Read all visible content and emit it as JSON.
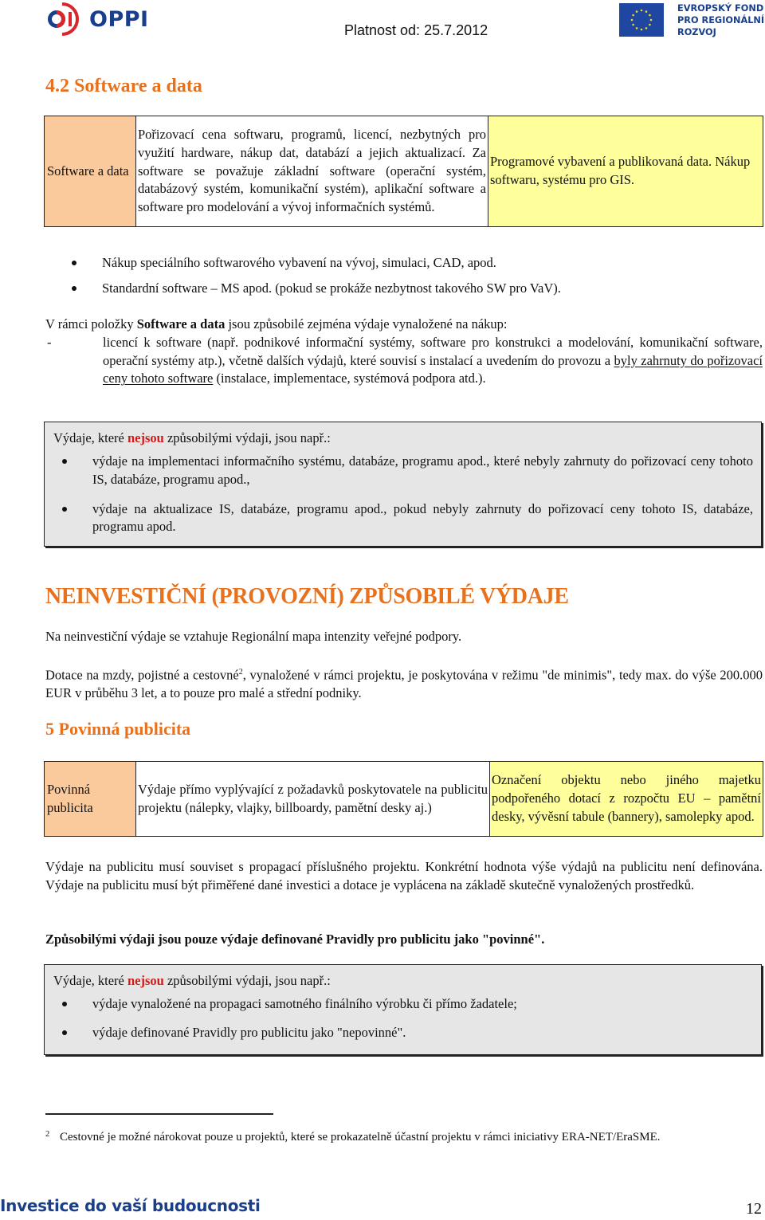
{
  "header": {
    "logo_text": "OPPI",
    "validity": "Platnost od: 25.7.2012",
    "eu_lines": [
      "EVROPSKÝ FOND",
      "PRO REGIONÁLNÍ",
      "ROZVOJ"
    ]
  },
  "colors": {
    "heading_orange": "#e8711e",
    "label_cell": "#fbca9c",
    "example_cell": "#fefe9a",
    "gray_box": "#e6e6e6",
    "emphasis_red": "#d11a1a",
    "brand_blue": "#1a3f8a"
  },
  "section_software": {
    "heading": "4.2 Software a data",
    "table": {
      "label": "Software a data",
      "description": "Pořizovací cena softwaru, programů, licencí, nezbytných pro využití hardware, nákup dat, databází a jejich aktualizací. Za software se považuje základní software (operační systém, databázový systém, komunikační systém), aplikační software a software pro modelování a vývoj informačních systémů.",
      "examples": "Programové vybavení a publikovaná data. Nákup softwaru, systému pro GIS."
    },
    "bullets": [
      "Nákup speciálního softwarového vybavení na vývoj, simulaci, CAD, apod.",
      "Standardní software – MS apod. (pokud se prokáže nezbytnost takového SW pro VaV)."
    ],
    "eligible_intro_pre": "V rámci položky ",
    "eligible_intro_bold": "Software a data",
    "eligible_intro_post": " jsou způsobilé zejména výdaje vynaložené na nákup:",
    "dash_item": {
      "dash": "-",
      "text_pre": "licencí k software (např. podnikové informační systémy, software pro konstrukci a modelování, komunikační software, operační systémy atp.), včetně dalších výdajů, které souvisí s instalací a uvedením do provozu a ",
      "text_underlined": "byly zahrnuty do pořizovací ceny tohoto software",
      "text_post": " (instalace, implementace, systémová podpora atd.)."
    },
    "ineligible_box": {
      "intro_pre": "Výdaje, které ",
      "intro_red": "nejsou",
      "intro_post": " způsobilými výdaji, jsou např.:",
      "items": [
        "výdaje na implementaci informačního systému, databáze, programu apod., které nebyly zahrnuty do pořizovací ceny tohoto IS, databáze, programu apod.,",
        "výdaje na aktualizace IS, databáze, programu apod., pokud nebyly zahrnuty do pořizovací ceny tohoto IS, databáze, programu apod."
      ]
    }
  },
  "section_noninvest": {
    "heading": "NEINVESTIČNÍ (PROVOZNÍ) ZPŮSOBILÉ VÝDAJE",
    "para1": "Na neinvestiční výdaje se vztahuje Regionální mapa intenzity veřejné podpory.",
    "para2_pre": "Dotace na mzdy, pojistné a cestovné",
    "para2_sup": "2",
    "para2_post": ", vynaložené v rámci projektu, je poskytována v režimu \"de minimis\", tedy max. do výše 200.000 EUR v průběhu 3 let, a to pouze pro malé a střední podniky."
  },
  "section_publicity": {
    "heading": "5 Povinná publicita",
    "table": {
      "label": "Povinná publicita",
      "description": "Výdaje přímo vyplývající z požadavků poskytovatele na publicitu projektu (nálepky, vlajky, billboardy, pamětní desky aj.)",
      "examples": "Označení objektu nebo jiného majetku podpořeného dotací z rozpočtu EU – pamětní desky, vývěsní tabule (bannery), samolepky apod."
    },
    "para1": "Výdaje na publicitu musí souviset s propagací příslušného projektu. Konkrétní hodnota výše výdajů na publicitu není definována. Výdaje na publicitu musí být přiměřené dané investici a dotace je vyplácena na základě skutečně vynaložených prostředků.",
    "para_bold": "Způsobilými výdaji jsou pouze výdaje definované Pravidly pro publicitu jako \"povinné\".",
    "ineligible_box": {
      "intro_pre": "Výdaje, které ",
      "intro_red": "nejsou",
      "intro_post": " způsobilými výdaji, jsou např.:",
      "items": [
        "výdaje vynaložené na propagaci samotného finálního výrobku či přímo žadatele;",
        "výdaje definované Pravidly pro publicitu jako \"nepovinné\"."
      ]
    }
  },
  "footnote": {
    "mark": "2",
    "text": "Cestovné je možné nárokovat pouze u projektů, které se prokazatelně účastní projektu v rámci iniciativy ERA-NET/EraSME."
  },
  "footer": {
    "slogan": "Investice do vaší budoucnosti",
    "page_number": "12"
  }
}
